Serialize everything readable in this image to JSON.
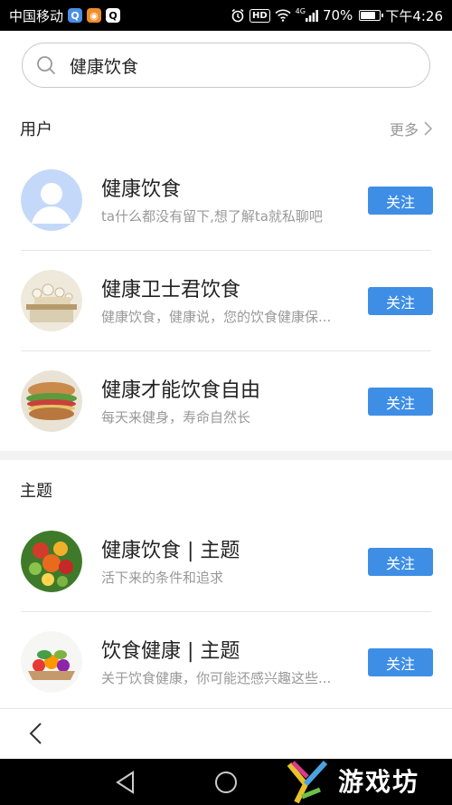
{
  "status_bar": {
    "carrier": "中国移动",
    "network": "4G",
    "battery": "70%",
    "time": "下午4:26"
  },
  "search": {
    "value": "健康饮食"
  },
  "users_section": {
    "title": "用户",
    "more": "更多",
    "items": [
      {
        "name": "健康饮食",
        "desc": "ta什么都没有留下,想了解ta就私聊吧",
        "follow": "关注"
      },
      {
        "name": "健康卫士君饮食",
        "desc": "健康饮食，健康说，您的饮食健康保...",
        "follow": "关注"
      },
      {
        "name": "健康才能饮食自由",
        "desc": "每天来健身，寿命自然长",
        "follow": "关注"
      }
    ]
  },
  "topics_section": {
    "title": "主题",
    "items": [
      {
        "name": "健康饮食 | 主题",
        "desc": "活下来的条件和追求",
        "follow": "关注"
      },
      {
        "name": "饮食健康 | 主题",
        "desc": "关于饮食健康，你可能还感兴趣这些...",
        "follow": "关注"
      }
    ]
  },
  "watermark": {
    "text": "游戏坊"
  },
  "colors": {
    "accent": "#3e8ee6",
    "divider": "#e6e6e6",
    "section_gap": "#f2f2f2"
  }
}
